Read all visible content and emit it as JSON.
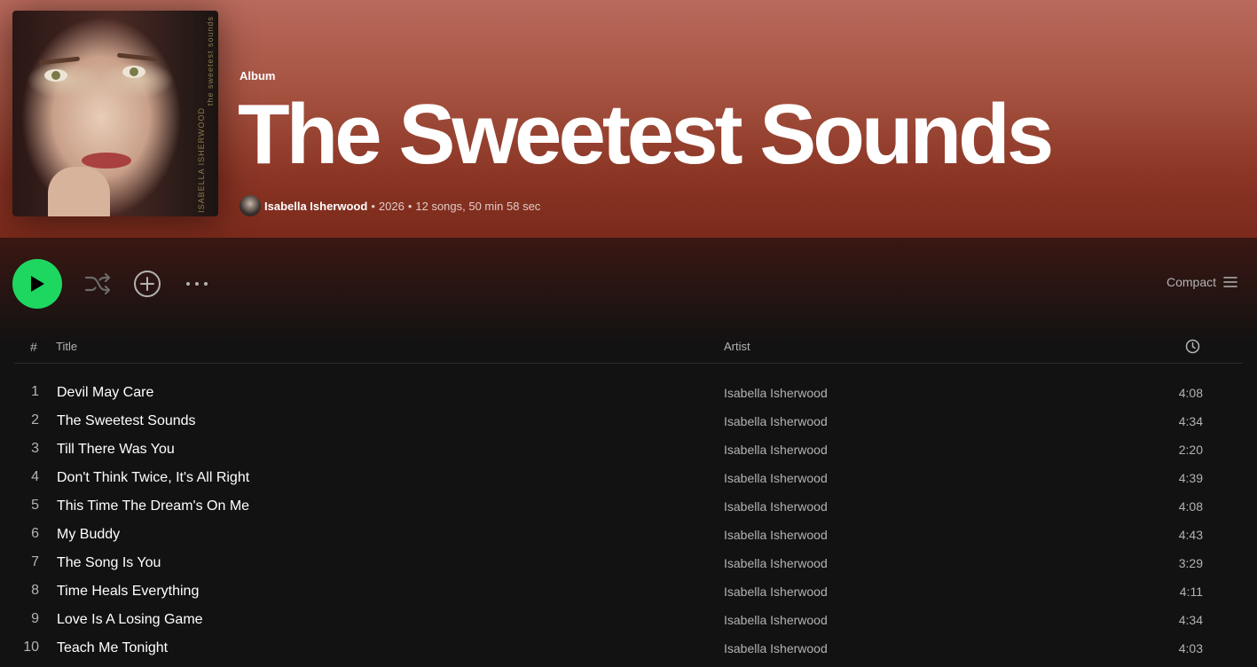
{
  "album": {
    "type_label": "Album",
    "title": "The Sweetest Sounds",
    "artist": "Isabella Isherwood",
    "year": "2026",
    "summary": "12 songs, 50 min 58 sec",
    "cover_spine_title": "the sweetest sounds",
    "cover_spine_artist": "ISABELLA ISHERWOOD"
  },
  "controls": {
    "compact_label": "Compact",
    "play_icon": "play-icon",
    "shuffle_icon": "shuffle-icon",
    "add_icon": "add-circle-icon",
    "more_icon": "more-options-icon",
    "list_icon": "list-icon"
  },
  "table": {
    "col_num": "#",
    "col_title": "Title",
    "col_artist": "Artist",
    "col_duration_icon": "clock-icon"
  },
  "tracks": [
    {
      "num": "1",
      "title": "Devil May Care",
      "artist": "Isabella Isherwood",
      "duration": "4:08"
    },
    {
      "num": "2",
      "title": "The Sweetest Sounds",
      "artist": "Isabella Isherwood",
      "duration": "4:34"
    },
    {
      "num": "3",
      "title": "Till There Was You",
      "artist": "Isabella Isherwood",
      "duration": "2:20"
    },
    {
      "num": "4",
      "title": "Don't Think Twice, It's All Right",
      "artist": "Isabella Isherwood",
      "duration": "4:39"
    },
    {
      "num": "5",
      "title": "This Time The Dream's On Me",
      "artist": "Isabella Isherwood",
      "duration": "4:08"
    },
    {
      "num": "6",
      "title": "My Buddy",
      "artist": "Isabella Isherwood",
      "duration": "4:43"
    },
    {
      "num": "7",
      "title": "The Song Is You",
      "artist": "Isabella Isherwood",
      "duration": "3:29"
    },
    {
      "num": "8",
      "title": "Time Heals Everything",
      "artist": "Isabella Isherwood",
      "duration": "4:11"
    },
    {
      "num": "9",
      "title": "Love Is A Losing Game",
      "artist": "Isabella Isherwood",
      "duration": "4:34"
    },
    {
      "num": "10",
      "title": "Teach Me Tonight",
      "artist": "Isabella Isherwood",
      "duration": "4:03"
    }
  ],
  "colors": {
    "accent_green": "#1ed760",
    "hero_top": "#b96a5c",
    "hero_bottom": "#7a2a1b",
    "background": "#121212"
  }
}
